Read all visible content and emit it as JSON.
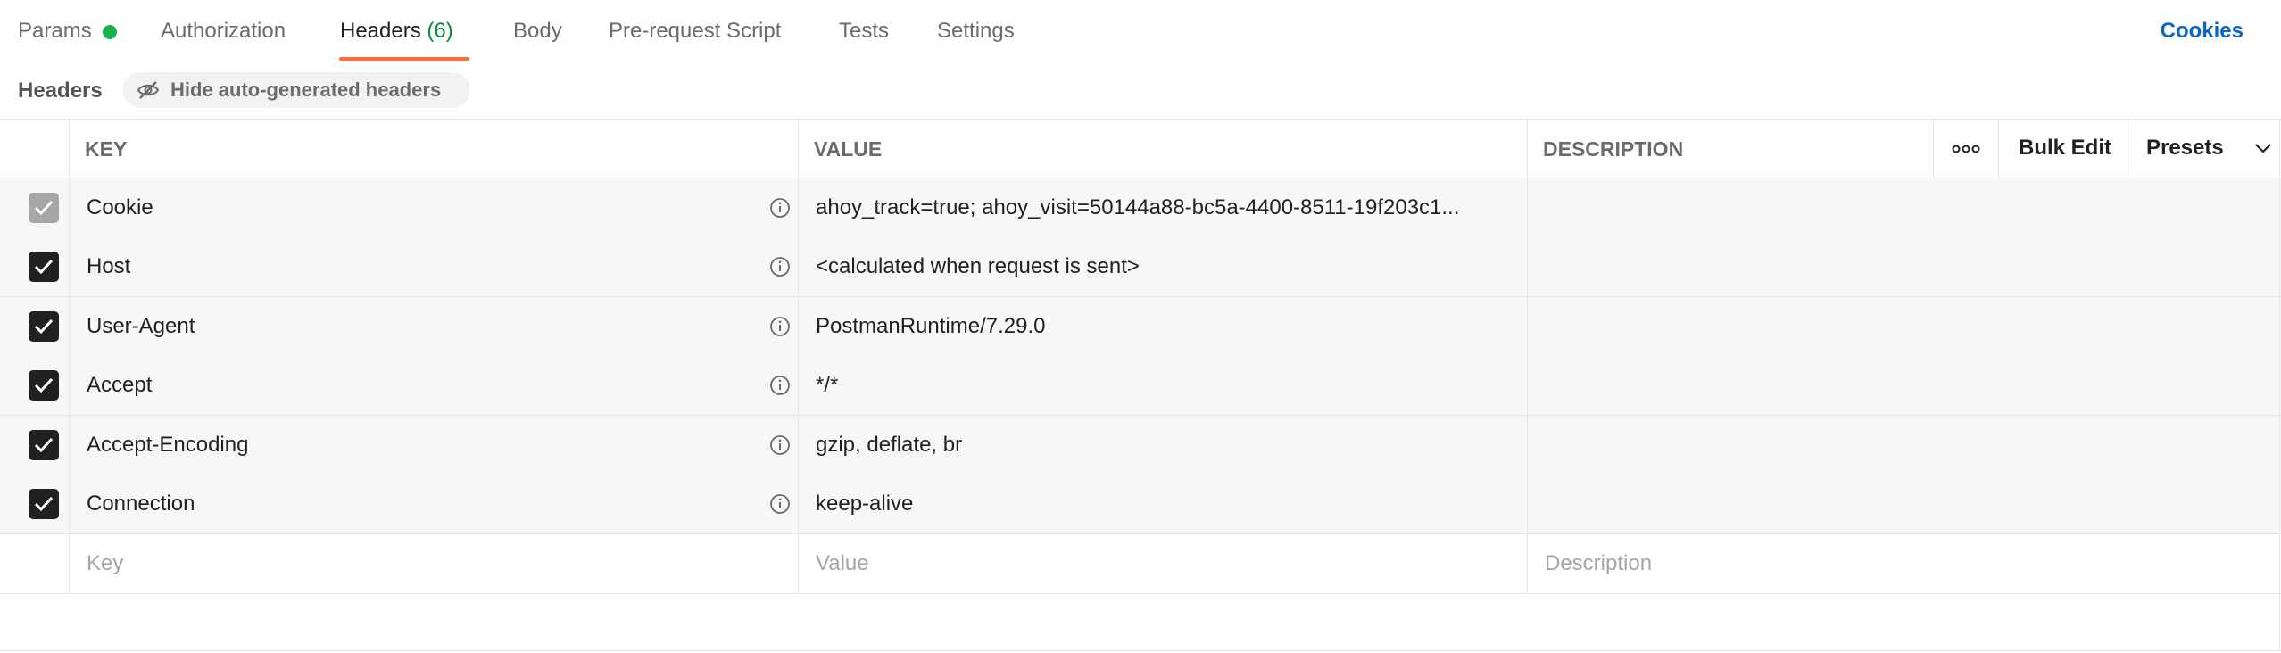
{
  "tabs": [
    {
      "label": "Params"
    },
    {
      "label": "Authorization"
    },
    {
      "label": "Headers",
      "count": "(6)"
    },
    {
      "label": "Body"
    },
    {
      "label": "Pre-request Script"
    },
    {
      "label": "Tests"
    },
    {
      "label": "Settings"
    }
  ],
  "active_tab": "Headers",
  "cookies_label": "Cookies",
  "headers_section": {
    "title": "Headers",
    "hide_button_label": "Hide auto-generated headers"
  },
  "table": {
    "columns": {
      "key": "KEY",
      "value": "VALUE",
      "description": "DESCRIPTION"
    },
    "more_button": "◦◦◦",
    "bulk_edit_label": "Bulk Edit",
    "presets_label": "Presets",
    "rows": [
      {
        "enabled": true,
        "disabled_checkbox": true,
        "key": "Cookie",
        "value": "ahoy_track=true; ahoy_visit=50144a88-bc5a-4400-8511-19f203c1...",
        "description": ""
      },
      {
        "enabled": true,
        "key": "Host",
        "value": "<calculated when request is sent>",
        "description": ""
      },
      {
        "enabled": true,
        "key": "User-Agent",
        "value": "PostmanRuntime/7.29.0",
        "description": ""
      },
      {
        "enabled": true,
        "key": "Accept",
        "value": "*/*",
        "description": ""
      },
      {
        "enabled": true,
        "key": "Accept-Encoding",
        "value": "gzip, deflate, br",
        "description": ""
      },
      {
        "enabled": true,
        "key": "Connection",
        "value": "keep-alive",
        "description": ""
      }
    ],
    "new_row_placeholders": {
      "key": "Key",
      "value": "Value",
      "description": "Description"
    }
  },
  "colors": {
    "accent_underline": "#ff6c37",
    "params_status_dot": "#18b24b",
    "headers_count": "#0e8a3c",
    "cookies_link": "#0b65c2"
  },
  "icons": {
    "params_status": "status-dot-icon",
    "hide_button": "eye-slash-icon",
    "row_info": "info-icon",
    "checkbox": "checkmark-icon",
    "presets": "chevron-down-icon",
    "more": "more-horizontal-icon"
  }
}
